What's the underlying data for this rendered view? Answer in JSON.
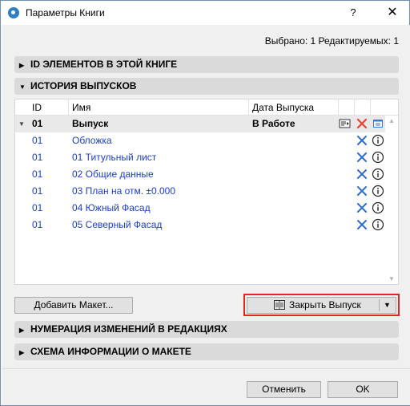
{
  "window": {
    "title": "Параметры Книги",
    "help_label": "?",
    "close_label": "✕"
  },
  "selection_info": "Выбрано: 1 Редактируемых: 1",
  "sections": {
    "ids": "ID ЭЛЕМЕНТОВ В ЭТОЙ КНИГЕ",
    "history": "ИСТОРИЯ ВЫПУСКОВ",
    "numbering": "НУМЕРАЦИЯ ИЗМЕНЕНИЙ В РЕДАКЦИЯХ",
    "layout_info": "СХЕМА ИНФОРМАЦИИ О МАКЕТЕ"
  },
  "table": {
    "headers": {
      "id": "ID",
      "name": "Имя",
      "date": "Дата Выпуска"
    },
    "parent": {
      "id": "01",
      "name": "Выпуск",
      "date": "В Работе"
    },
    "rows": [
      {
        "id": "01",
        "name": "Обложка"
      },
      {
        "id": "01",
        "name": "01 Титульный лист"
      },
      {
        "id": "01",
        "name": "02 Общие данные"
      },
      {
        "id": "01",
        "name": "03 План на отм. ±0.000"
      },
      {
        "id": "01",
        "name": "04 Южный Фасад"
      },
      {
        "id": "01",
        "name": "05 Северный Фасад"
      }
    ]
  },
  "buttons": {
    "add_layout": "Добавить Макет...",
    "close_issue": "Закрыть Выпуск",
    "cancel": "Отменить",
    "ok": "OK"
  },
  "colors": {
    "link_blue": "#1b3ec9",
    "delete_red": "#e8452a",
    "highlight_red": "#e0241f"
  }
}
